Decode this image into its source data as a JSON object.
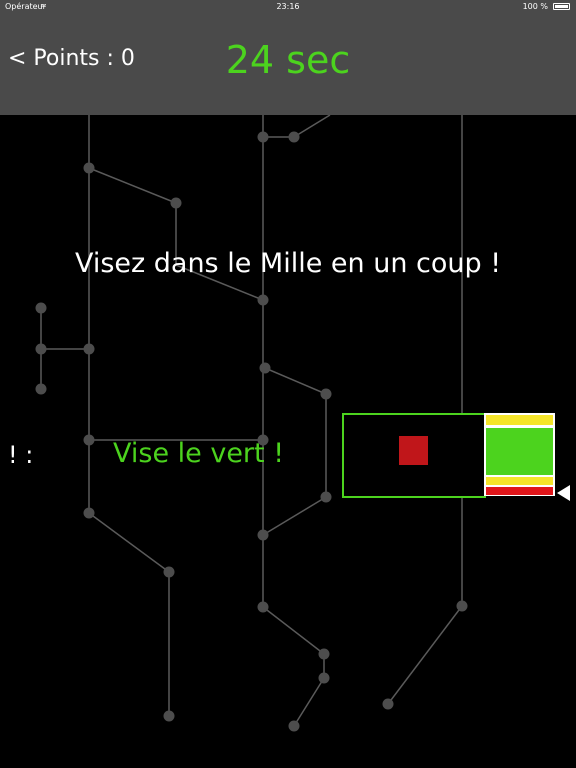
{
  "status_bar": {
    "carrier": "Opérateur",
    "time": "23:16",
    "battery": "100 %"
  },
  "header": {
    "points_label": "< Points : 0",
    "timer": "24 sec"
  },
  "game": {
    "instruction": "Visez dans le Mille en un coup !",
    "exclamation": "!  :",
    "hint": "Vise le vert !"
  },
  "colors": {
    "header_bg": "#4a4a4a",
    "accent_green": "#4cd31e",
    "target_red": "#c0161a",
    "meter_yellow": "#f5e52a",
    "meter_red": "#e0151a"
  },
  "icons": {
    "wifi": "wifi-icon",
    "battery": "battery-icon",
    "pointer": "triangle-left-icon"
  }
}
